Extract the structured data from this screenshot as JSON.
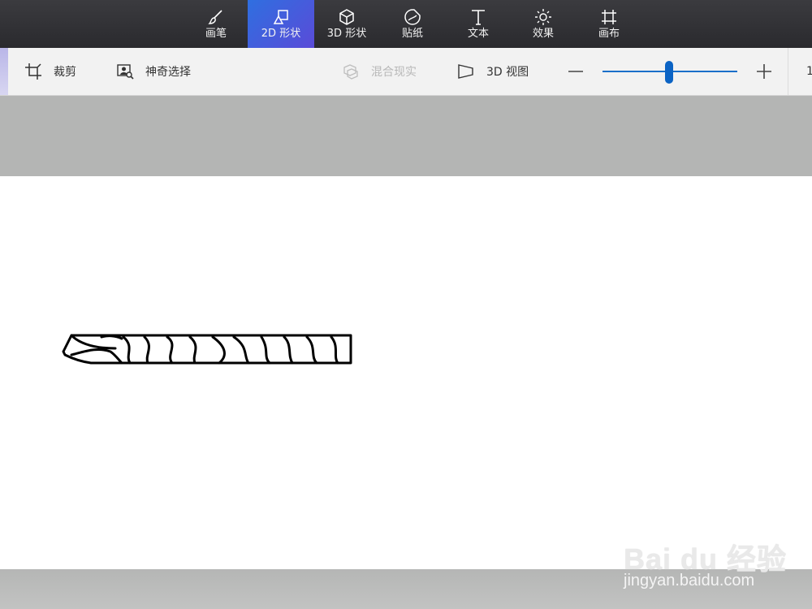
{
  "top_tabs": [
    {
      "label": "画笔",
      "icon": "brush-icon"
    },
    {
      "label": "2D 形状",
      "icon": "2d-shapes-icon"
    },
    {
      "label": "3D 形状",
      "icon": "3d-cube-icon"
    },
    {
      "label": "贴纸",
      "icon": "sticker-icon"
    },
    {
      "label": "文本",
      "icon": "text-t-icon"
    },
    {
      "label": "效果",
      "icon": "sun-effects-icon"
    },
    {
      "label": "画布",
      "icon": "canvas-crop-icon"
    }
  ],
  "active_tab": "2D 形状",
  "toolbar": {
    "crop_label": "裁剪",
    "magic_select_label": "神奇选择",
    "mixed_reality_label": "混合现实",
    "view_3d_label": "3D 视图",
    "zoom_value": "1"
  },
  "zoom_slider_level": 0.5,
  "watermark": {
    "logo_text": "Bai du 经验",
    "url": "jingyan.baidu.com"
  },
  "colors": {
    "top_bar": "#2f2f33",
    "active_tab": "#3f5fe0",
    "slider": "#0b63c4",
    "canvas": "#ffffff",
    "workspace": "#b4b5b4"
  }
}
